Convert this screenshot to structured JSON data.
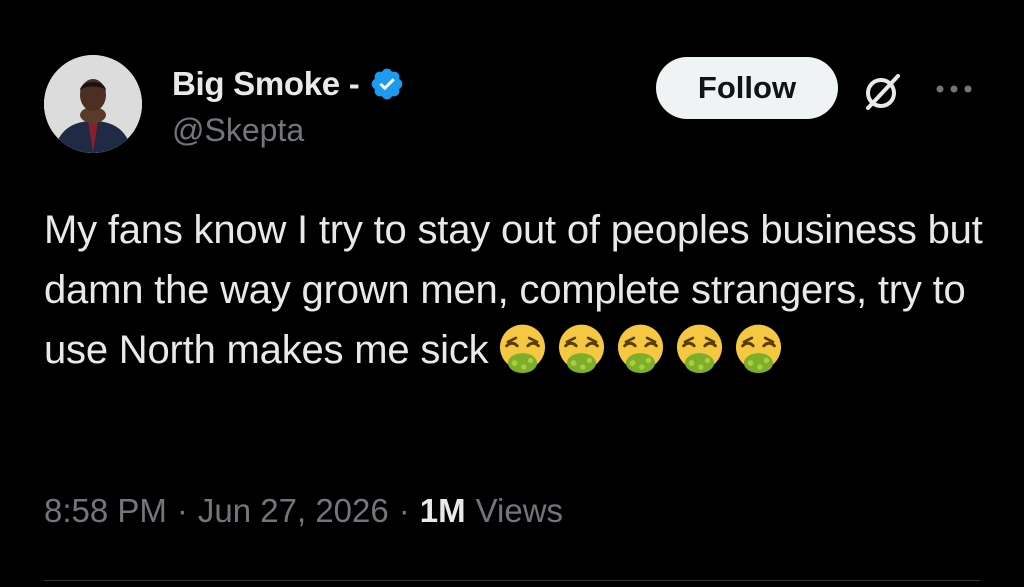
{
  "author": {
    "display_name": "Big Smoke -",
    "handle": "@Skepta",
    "verified": true
  },
  "actions": {
    "follow_label": "Follow",
    "grok_icon": "grok-icon",
    "more_icon": "more-icon"
  },
  "tweet": {
    "text": "My fans know I try to stay out of peoples business but damn the way grown men, complete strangers, try to use North makes me sick",
    "emoji": [
      "nauseated-face",
      "nauseated-face",
      "nauseated-face",
      "nauseated-face",
      "nauseated-face"
    ]
  },
  "meta": {
    "time": "8:58 PM",
    "date": "Jun 27, 2026",
    "separator": "·",
    "views_count": "1M",
    "views_label": "Views"
  },
  "colors": {
    "background": "#000000",
    "text_primary": "#e7e9ea",
    "text_secondary": "#71767b",
    "verified_blue": "#1d9bf0",
    "follow_bg": "#eff3f4"
  }
}
